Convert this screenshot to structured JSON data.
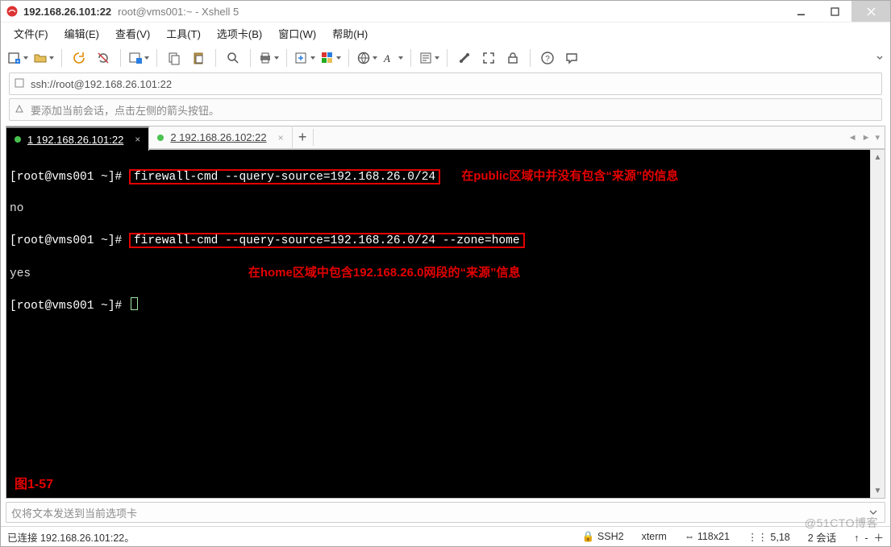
{
  "window": {
    "title_main": "192.168.26.101:22",
    "title_sub": "root@vms001:~ - Xshell 5"
  },
  "menu": {
    "file": "文件(F)",
    "edit": "编辑(E)",
    "view": "查看(V)",
    "tools": "工具(T)",
    "tabs": "选项卡(B)",
    "window": "窗口(W)",
    "help": "帮助(H)"
  },
  "address": {
    "url": "ssh://root@192.168.26.101:22"
  },
  "hint": {
    "text": "要添加当前会话，点击左侧的箭头按钮。"
  },
  "tabs": [
    {
      "index": "1",
      "label": "192.168.26.101:22",
      "active": true
    },
    {
      "index": "2",
      "label": "192.168.26.102:22",
      "active": false
    }
  ],
  "terminal": {
    "line1_prompt": "[root@vms001 ~]# ",
    "line1_cmd": "firewall-cmd --query-source=192.168.26.0/24",
    "line1_annot": "在public区域中并没有包含“来源”的信息",
    "line2_out": "no",
    "line3_prompt": "[root@vms001 ~]# ",
    "line3_cmd": "firewall-cmd --query-source=192.168.26.0/24 --zone=home",
    "line4_out": "yes",
    "line4_annot": "在home区域中包含192.168.26.0网段的“来源”信息",
    "line5_prompt": "[root@vms001 ~]# ",
    "figure_label": "图1-57"
  },
  "sendbar": {
    "placeholder": "仅将文本发送到当前选项卡"
  },
  "status": {
    "conn": "已连接 192.168.26.101:22。",
    "proto": "SSH2",
    "term": "xterm",
    "size": "118x21",
    "cursor": "5,18",
    "sessions_label": "2 会话"
  },
  "watermark": "@51CTO博客",
  "icons": {
    "app": "xshell-icon"
  }
}
